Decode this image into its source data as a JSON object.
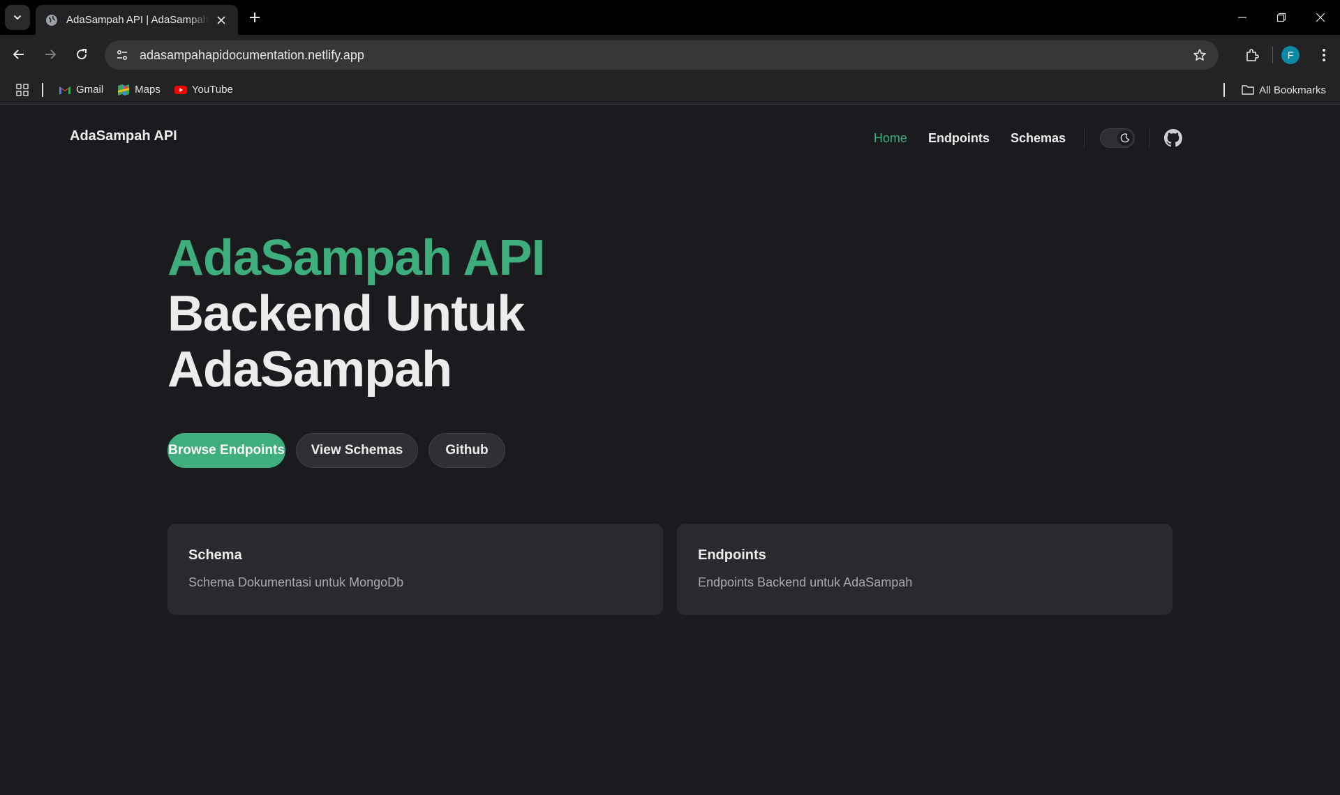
{
  "browser": {
    "tab_title": "AdaSampah API | AdaSampah API",
    "url": "adasampahapidocumentation.netlify.app",
    "profile_initial": "F",
    "bookmarks": [
      {
        "label": "Gmail",
        "icon": "gmail-icon"
      },
      {
        "label": "Maps",
        "icon": "maps-icon"
      },
      {
        "label": "YouTube",
        "icon": "youtube-icon"
      }
    ],
    "all_bookmarks_label": "All Bookmarks"
  },
  "site": {
    "brand": "AdaSampah API",
    "nav": {
      "home": "Home",
      "endpoints": "Endpoints",
      "schemas": "Schemas"
    },
    "hero": {
      "name": "AdaSampah API",
      "tagline_line1": "Backend Untuk",
      "tagline_line2": "AdaSampah"
    },
    "actions": {
      "browse": "Browse Endpoints",
      "schemas": "View Schemas",
      "github": "Github"
    },
    "features": [
      {
        "title": "Schema",
        "details": "Schema Dokumentasi untuk MongoDb"
      },
      {
        "title": "Endpoints",
        "details": "Endpoints Backend untuk AdaSampah"
      }
    ]
  },
  "colors": {
    "brand_green": "#3eaf7c",
    "page_bg": "#1b1b1f",
    "card_bg": "#2a2a2e"
  }
}
